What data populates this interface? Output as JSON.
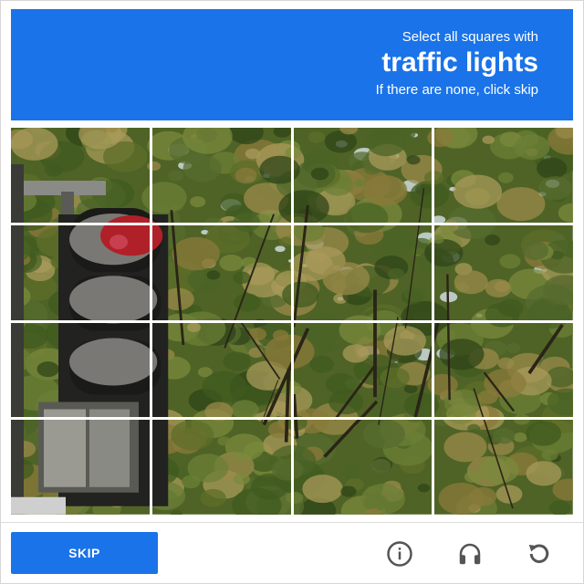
{
  "header": {
    "line1": "Select all squares with",
    "target": "traffic lights",
    "line3": "If there are none, click skip",
    "background": "#1a73e8"
  },
  "grid": {
    "rows": 4,
    "columns": 4
  },
  "footer": {
    "skip_label": "SKIP",
    "icons": [
      "info-icon",
      "headphones-icon",
      "reload-icon"
    ]
  },
  "colors": {
    "accent": "#1a73e8",
    "icon": "#555555"
  }
}
